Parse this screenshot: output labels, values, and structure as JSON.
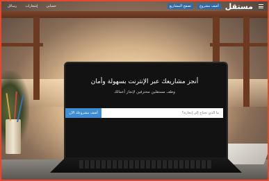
{
  "nav": {
    "logo": "مستقل",
    "right_links": [
      "أضف مشروع",
      "تصفح المشاريع"
    ],
    "left_links": [
      "حسابي",
      "إشعارات",
      "رسائل"
    ]
  },
  "hero": {
    "title": "أنجز مشاريعك عبر الإنترنت بسهولة وأمان",
    "subtitle": "وظف مستقلين محترفين لإنجاز أعمالك"
  },
  "search": {
    "placeholder": "ما الذي تحتاج إلى إنجازه؟",
    "button_label": "أضف مشروعك الآن"
  },
  "colors": {
    "brand": "#2d6ba8",
    "accent": "#3f8ed3",
    "frame": "#e8472f"
  }
}
